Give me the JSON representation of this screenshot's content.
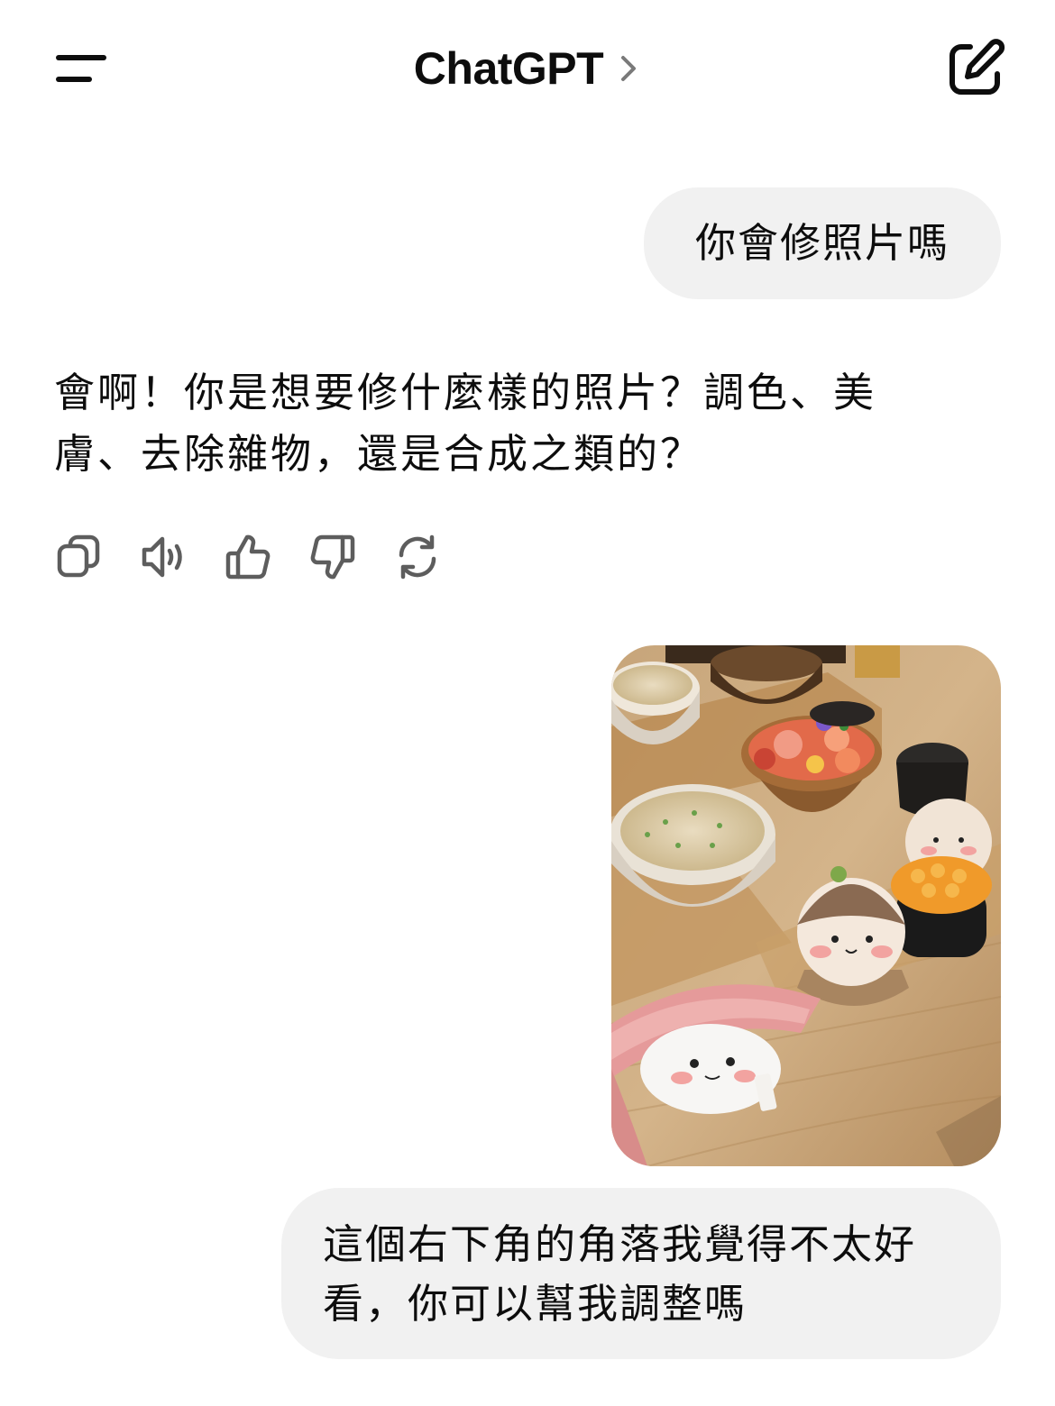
{
  "header": {
    "title": "ChatGPT",
    "menu_icon": "menu-icon",
    "chevron_icon": "chevron-right-icon",
    "new_chat_icon": "new-chat-icon"
  },
  "messages": [
    {
      "role": "user",
      "text": "你會修照片嗎"
    },
    {
      "role": "assistant",
      "lines": [
        "會啊！你是想要修什麼樣的照片？調色、美",
        "膚、去除雜物，還是合成之類的？"
      ]
    },
    {
      "role": "user",
      "type": "image"
    },
    {
      "role": "user",
      "lines": [
        "這個右下角的角落我覺得不太好",
        "看，你可以幫我調整嗎"
      ]
    }
  ],
  "message_actions": [
    "copy-icon",
    "read-aloud-icon",
    "thumbs-up-icon",
    "thumbs-down-icon",
    "regenerate-icon"
  ],
  "colors": {
    "bubble_bg": "#f1f1f1",
    "text": "#0d0d0d",
    "icon_muted": "#5d5d5d"
  }
}
